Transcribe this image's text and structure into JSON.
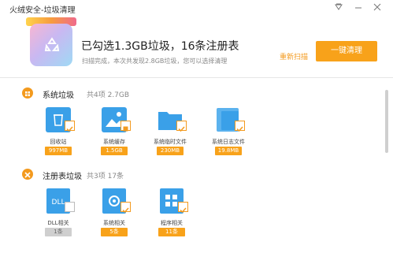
{
  "window": {
    "title": "火绒安全-垃圾清理",
    "controls": [
      "menu-icon",
      "minimize-icon",
      "close-icon"
    ]
  },
  "summary": {
    "title": "已勾选1.3GB垃圾，16条注册表",
    "subtitle": "扫描完成，本次共发现2.8GB垃圾，您可以选择清理",
    "rescan_label": "重新扫描",
    "clean_label": "一键清理"
  },
  "accent_color": "#f8a21a",
  "sections": [
    {
      "title": "系统垃圾",
      "meta": "共4项 2.7GB",
      "items": [
        {
          "label": "回收站",
          "size": "997MB",
          "icon": "recycle-bin-icon",
          "checked": true
        },
        {
          "label": "系统缓存",
          "size": "1.5GB",
          "icon": "image-cache-icon",
          "checked": "partial"
        },
        {
          "label": "系统临时文件",
          "size": "230MB",
          "icon": "folder-icon",
          "checked": true
        },
        {
          "label": "系统日志文件",
          "size": "19.8MB",
          "icon": "log-file-icon",
          "checked": true
        }
      ]
    },
    {
      "title": "注册表垃圾",
      "meta": "共3项 17条",
      "items": [
        {
          "label": "DLL相关",
          "size": "1条",
          "icon": "dll-icon",
          "checked": false
        },
        {
          "label": "系统相关",
          "size": "5条",
          "icon": "gear-icon",
          "checked": true
        },
        {
          "label": "程序相关",
          "size": "11条",
          "icon": "app-grid-icon",
          "checked": true
        }
      ]
    }
  ]
}
